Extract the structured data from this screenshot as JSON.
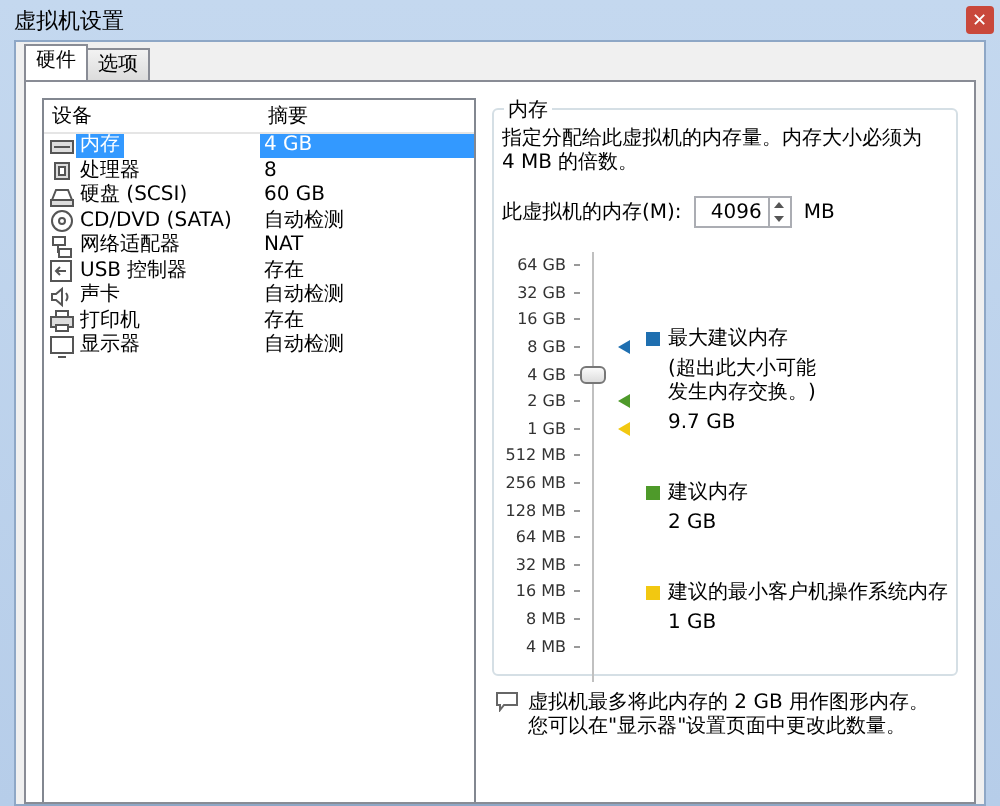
{
  "window": {
    "title": "虚拟机设置",
    "close": "✕"
  },
  "tabs": [
    {
      "label": "硬件",
      "selected": true
    },
    {
      "label": "选项",
      "selected": false
    }
  ],
  "devices": {
    "columns": [
      "设备",
      "摘要"
    ],
    "rows": [
      {
        "kind": "memory",
        "name": "内存",
        "summary": "4 GB",
        "selected": true
      },
      {
        "kind": "cpu",
        "name": "处理器",
        "summary": "8",
        "selected": false
      },
      {
        "kind": "disk",
        "name": "硬盘 (SCSI)",
        "summary": "60 GB",
        "selected": false
      },
      {
        "kind": "cd",
        "name": "CD/DVD (SATA)",
        "summary": "自动检测",
        "selected": false
      },
      {
        "kind": "network",
        "name": "网络适配器",
        "summary": "NAT",
        "selected": false
      },
      {
        "kind": "usb",
        "name": "USB 控制器",
        "summary": "存在",
        "selected": false
      },
      {
        "kind": "sound",
        "name": "声卡",
        "summary": "自动检测",
        "selected": false
      },
      {
        "kind": "printer",
        "name": "打印机",
        "summary": "存在",
        "selected": false
      },
      {
        "kind": "display",
        "name": "显示器",
        "summary": "自动检测",
        "selected": false
      }
    ]
  },
  "memory": {
    "title": "内存",
    "description": "指定分配给此虚拟机的内存量。内存大小必须为 4 MB 的倍数。",
    "field_label": "此虚拟机的内存(M):",
    "value": "4096",
    "unit": "MB",
    "slider": {
      "level": 0.714,
      "ticks": [
        {
          "label": "64 GB"
        },
        {
          "label": "32 GB"
        },
        {
          "label": "16 GB"
        },
        {
          "label": "8 GB",
          "color": "#1f6fb0"
        },
        {
          "label": "4 GB"
        },
        {
          "label": "2 GB",
          "color": "#4e9a2a"
        },
        {
          "label": "1 GB",
          "color": "#f2c811"
        },
        {
          "label": "512 MB"
        },
        {
          "label": "256 MB"
        },
        {
          "label": "128 MB"
        },
        {
          "label": "64 MB"
        },
        {
          "label": "32 MB"
        },
        {
          "label": "16 MB"
        },
        {
          "label": "8 MB"
        },
        {
          "label": "4 MB"
        }
      ]
    },
    "legend": [
      {
        "color": "#1f6fb0",
        "label": "最大建议内存",
        "note": "(超出此大小可能发生内存交换。)",
        "value": "9.7 GB"
      },
      {
        "color": "#4e9a2a",
        "label": "建议内存",
        "value": "2 GB"
      },
      {
        "color": "#f2c811",
        "label": "建议的最小客户机操作系统内存",
        "value": "1 GB"
      }
    ]
  },
  "note": "虚拟机最多将此内存的 2 GB 用作图形内存。您可以在\"显示器\"设置页面中更改此数量。"
}
